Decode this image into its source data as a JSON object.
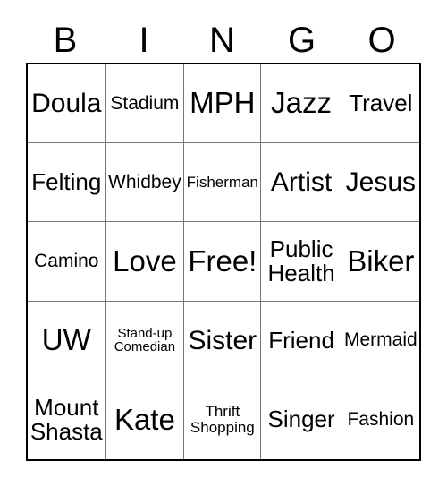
{
  "header": {
    "letters": [
      "B",
      "I",
      "N",
      "G",
      "O"
    ]
  },
  "grid": {
    "rows": [
      [
        {
          "label": "Doula",
          "size": "t-lg"
        },
        {
          "label": "Stadium",
          "size": "t-sm"
        },
        {
          "label": "MPH",
          "size": "t-xl"
        },
        {
          "label": "Jazz",
          "size": "t-xl"
        },
        {
          "label": "Travel",
          "size": "t-md"
        }
      ],
      [
        {
          "label": "Felting",
          "size": "t-md"
        },
        {
          "label": "Whidbey",
          "size": "t-sm"
        },
        {
          "label": "Fisherman",
          "size": "t-xs"
        },
        {
          "label": "Artist",
          "size": "t-lg"
        },
        {
          "label": "Jesus",
          "size": "t-lg"
        }
      ],
      [
        {
          "label": "Camino",
          "size": "t-sm"
        },
        {
          "label": "Love",
          "size": "t-xl"
        },
        {
          "label": "Free!",
          "size": "t-xl"
        },
        {
          "label": "Public\nHealth",
          "size": "t-md"
        },
        {
          "label": "Biker",
          "size": "t-xl"
        }
      ],
      [
        {
          "label": "UW",
          "size": "t-xl"
        },
        {
          "label": "Stand-up\nComedian",
          "size": "t-2xs"
        },
        {
          "label": "Sister",
          "size": "t-lg"
        },
        {
          "label": "Friend",
          "size": "t-md"
        },
        {
          "label": "Mermaid",
          "size": "t-sm"
        }
      ],
      [
        {
          "label": "Mount\nShasta",
          "size": "t-md"
        },
        {
          "label": "Kate",
          "size": "t-xl"
        },
        {
          "label": "Thrift\nShopping",
          "size": "t-xs"
        },
        {
          "label": "Singer",
          "size": "t-md"
        },
        {
          "label": "Fashion",
          "size": "t-sm"
        }
      ]
    ]
  },
  "colors": {
    "outer_border": "#000000",
    "inner_border": "#777777",
    "background": "#ffffff",
    "text": "#000000"
  }
}
